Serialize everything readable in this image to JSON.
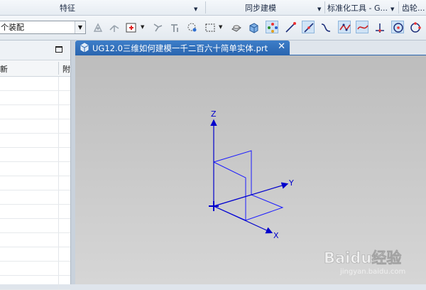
{
  "ribbon": {
    "groups": [
      {
        "label": "特征",
        "caret": "▼"
      },
      {
        "label": "同步建模",
        "caret": "▼"
      },
      {
        "label": "标准化工具 - G...",
        "caret": "▼"
      },
      {
        "label": "齿轮..."
      }
    ]
  },
  "toolbar": {
    "assembly_select_value": "个装配",
    "dropdown_arrow": "▼"
  },
  "resource_panel": {
    "columns": [
      "新",
      "附"
    ],
    "row_count": 15
  },
  "document": {
    "tab_title": "UG12.0三维如何建模一千二百六十简单实体.prt",
    "close_glyph": "✕"
  },
  "viewport": {
    "triad": {
      "x_label": "X",
      "y_label": "Y",
      "z_label": "Z"
    },
    "background_top": "#bdbdbd",
    "background_bottom": "#d6d6d6",
    "line_color": "#1a1aff"
  },
  "watermark": {
    "brand": "Baidu经验",
    "url": "jingyan.baidu.com"
  },
  "colors": {
    "tab_blue": "#2b66b0",
    "selected_tool_bg": "#cfe3f6"
  }
}
